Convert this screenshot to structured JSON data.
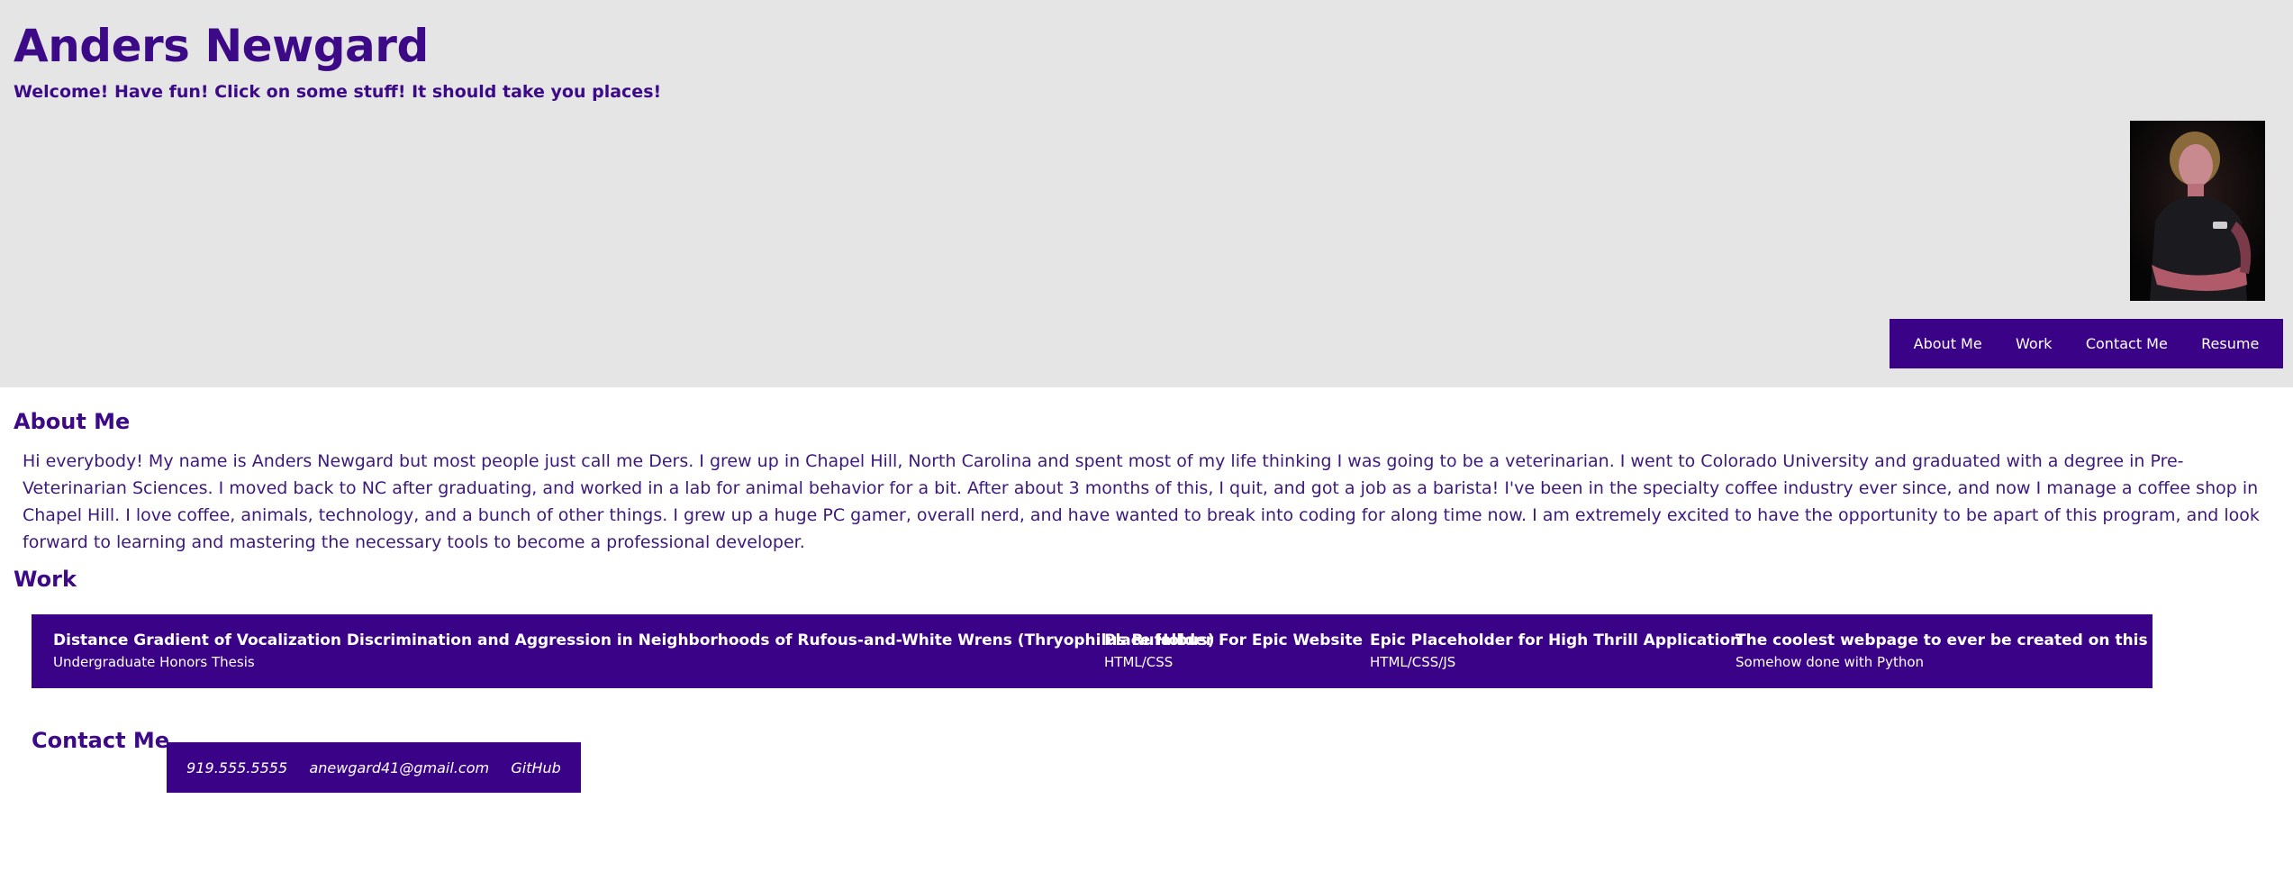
{
  "header": {
    "title": "Anders Newgard",
    "tagline": "Welcome! Have fun! Click on some stuff! It should take you places!"
  },
  "nav": {
    "items": [
      "About Me",
      "Work",
      "Contact Me",
      "Resume"
    ]
  },
  "about": {
    "heading": "About Me",
    "text": "Hi everybody! My name is Anders Newgard but most people just call me Ders. I grew up in Chapel Hill, North Carolina and spent most of my life thinking I was going to be a veterinarian. I went to Colorado University and graduated with a degree in Pre-Veterinarian Sciences. I moved back to NC after graduating, and worked in a lab for animal behavior for a bit. After about 3 months of this, I quit, and got a job as a barista! I've been in the specialty coffee industry ever since, and now I manage a coffee shop in Chapel Hill. I love coffee, animals, technology, and a bunch of other things. I grew up a huge PC gamer, overall nerd, and have wanted to break into coding for along time now. I am extremely excited to have the opportunity to be apart of this program, and look forward to learning and mastering the necessary tools to become a professional developer."
  },
  "work": {
    "heading": "Work",
    "projects": [
      {
        "title": "Distance Gradient of Vocalization Discrimination and Aggression in Neighborhoods of Rufous-and-White Wrens (Thryophilus Rufalbus)",
        "desc": "Undergraduate Honors Thesis"
      },
      {
        "title": "Place Holder For Epic Website",
        "desc": "HTML/CSS"
      },
      {
        "title": "Epic Placeholder for High Thrill Application",
        "desc": "HTML/CSS/JS"
      },
      {
        "title": "The coolest webpage to ever be created on this earth",
        "desc": "Somehow done with Python"
      }
    ]
  },
  "contact": {
    "heading": "Contact Me",
    "phone": "919.555.5555",
    "email": "anewgard41@gmail.com",
    "github": "GitHub"
  },
  "colors": {
    "accent": "#3a0387",
    "header_bg": "#e5e5e5",
    "text": "#3d0a87"
  }
}
